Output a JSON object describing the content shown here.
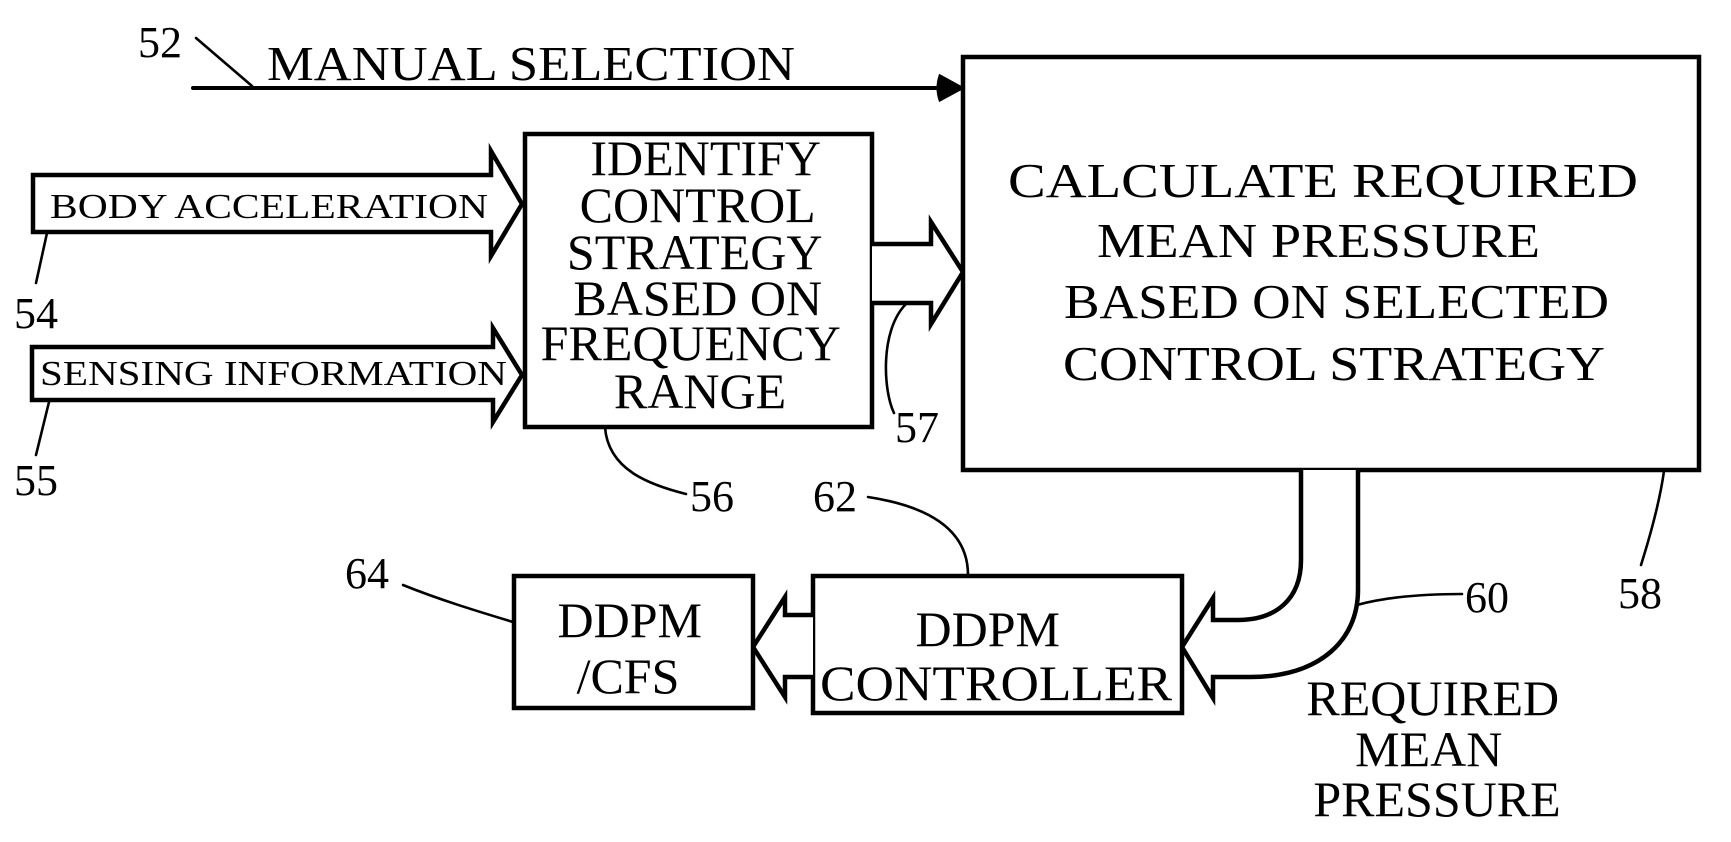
{
  "figure": {
    "manual_selection": {
      "label": "MANUAL SELECTION",
      "ref": "52"
    },
    "inputs": [
      {
        "label": "BODY ACCELERATION",
        "ref": "54"
      },
      {
        "label": "SENSING INFORMATION",
        "ref": "55"
      }
    ],
    "identify_block": {
      "lines": [
        "IDENTIFY",
        "CONTROL",
        "STRATEGY",
        "BASED ON",
        "FREQUENCY",
        "RANGE"
      ],
      "ref": "56",
      "output_ref": "57"
    },
    "calculate_block": {
      "lines": [
        "CALCULATE  REQUIRED",
        "MEAN  PRESSURE",
        "BASED ON SELECTED",
        "CONTROL STRATEGY"
      ],
      "ref": "58"
    },
    "pressure_signal": {
      "ref": "60",
      "label_lines": [
        "REQUIRED",
        "MEAN",
        "PRESSURE"
      ]
    },
    "controller_block": {
      "lines": [
        "DDPM",
        "CONTROLLER"
      ],
      "ref": "62"
    },
    "ddpm_block": {
      "lines": [
        "DDPM",
        "/CFS"
      ],
      "ref": "64"
    }
  }
}
